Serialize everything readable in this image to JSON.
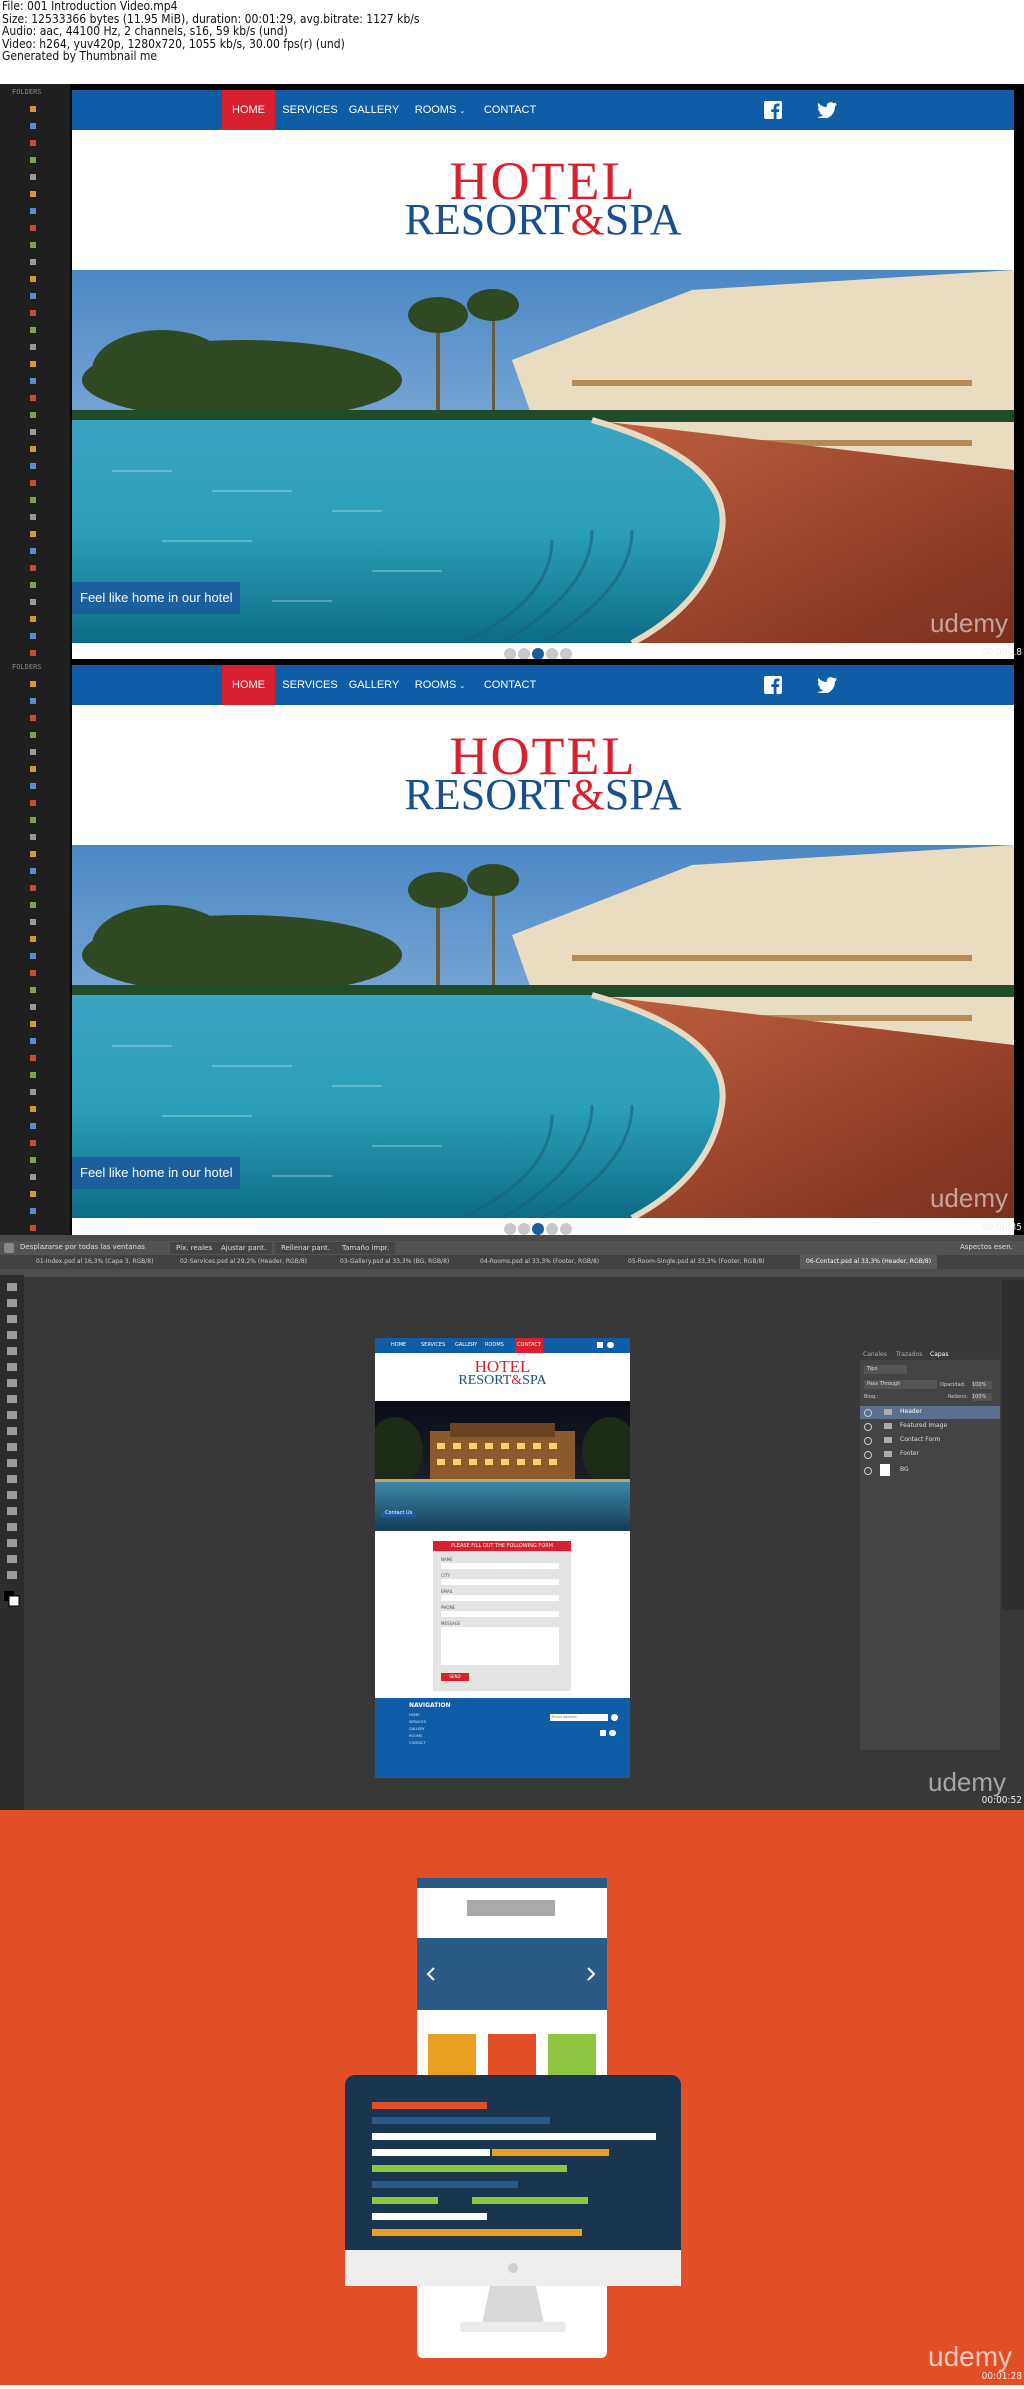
{
  "meta_lines": [
    "File: 001 Introduction Video.mp4",
    "Size: 12533366 bytes (11.95 MiB), duration: 00:01:29, avg.bitrate: 1127 kb/s",
    "Audio: aac, 44100 Hz, 2 channels, s16, 59 kb/s (und)",
    "Video: h264, yuv420p, 1280x720, 1055 kb/s, 30.00 fps(r) (und)",
    "Generated by Thumbnail me"
  ],
  "site": {
    "nav": [
      "HOME",
      "SERVICES",
      "GALLERY",
      "ROOMS",
      "CONTACT"
    ],
    "logo_line1": "HOTEL",
    "logo_line2a": "RESORT",
    "logo_amp": "&",
    "logo_line2b": "SPA",
    "caption": "Feel like home in our hotel",
    "watermark": "udemy"
  },
  "timestamps": [
    "00:00:18",
    "00:00:35",
    "00:00:52",
    "00:01:28"
  ],
  "editor_folder": "FOLDERS",
  "photoshop": {
    "options": [
      "Desplazarse por todas las ventanas",
      "Píx. reales",
      "Ajustar pant.",
      "Rellenar pant.",
      "Tamaño impr."
    ],
    "tabs": [
      "01-Index.psd al 16,3% (Capa 3, RGB/8)",
      "02-Services.psd al 29,2% (Header, RGB/8)",
      "03-Gallery.psd al 33,3% (BG, RGB/8)",
      "04-Rooms.psd al 33,3% (Footer, RGB/8)",
      "05-Room-Single.psd al 33,3% (Footer, RGB/8)",
      "06-Contact.psd al 33,3% (Header, RGB/8)"
    ],
    "workspace": "Aspectos esen.",
    "panel_tabs": [
      "Canales",
      "Trazados",
      "Capas"
    ],
    "layers": [
      "Header",
      "Featured Image",
      "Contact Form",
      "Footer",
      "BG"
    ],
    "blend": "Pass Through",
    "opacity_label": "Opacidad:",
    "opacity": "100%",
    "fill_label": "Relleno:",
    "fill": "100%",
    "lock_label": "Bloq.:",
    "kind": "Tipo",
    "mock_form_title": "PLEASE FILL OUT THE FOLLOWING FORM",
    "mock_fields": [
      "NAME",
      "CITY",
      "EMAIL",
      "PHONE",
      "MESSAGE"
    ],
    "mock_send": "SEND",
    "mock_nav_title": "NAVIGATION",
    "mock_nav_items": [
      "HOME",
      "SERVICES",
      "GALLERY",
      "ROOMS",
      "CONTACT"
    ],
    "mock_caption": "Contact Us",
    "mock_email": "Email Address"
  }
}
